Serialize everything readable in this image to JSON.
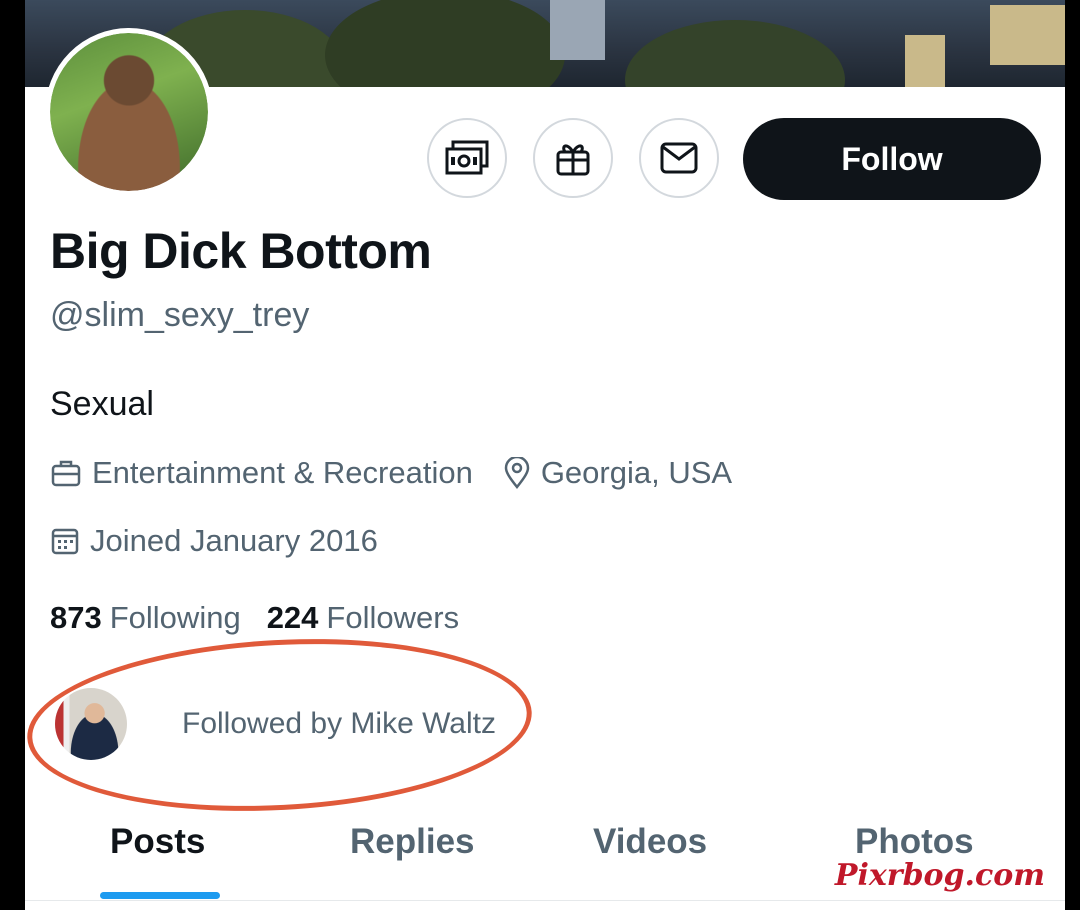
{
  "profile": {
    "name": "Big Dick Bottom",
    "handle": "@slim_sexy_trey",
    "bio": "Sexual",
    "category": "Entertainment & Recreation",
    "location": "Georgia, USA",
    "joined": "Joined January 2016"
  },
  "actions": {
    "follow_label": "Follow",
    "icons": [
      "money-icon",
      "gift-icon",
      "mail-icon"
    ]
  },
  "stats": {
    "following_count": "873",
    "following_label": "Following",
    "followers_count": "224",
    "followers_label": "Followers"
  },
  "followed_by": {
    "text": "Followed by Mike Waltz"
  },
  "tabs": [
    {
      "label": "Posts",
      "active": true
    },
    {
      "label": "Replies",
      "active": false
    },
    {
      "label": "Videos",
      "active": false
    },
    {
      "label": "Photos",
      "active": false
    }
  ],
  "watermark": "Pixrbog.com",
  "colors": {
    "accent": "#1d9bf0",
    "text_primary": "#0f1419",
    "text_secondary": "#536471",
    "highlight_circle": "#e05a3a",
    "watermark": "#c0182a"
  }
}
